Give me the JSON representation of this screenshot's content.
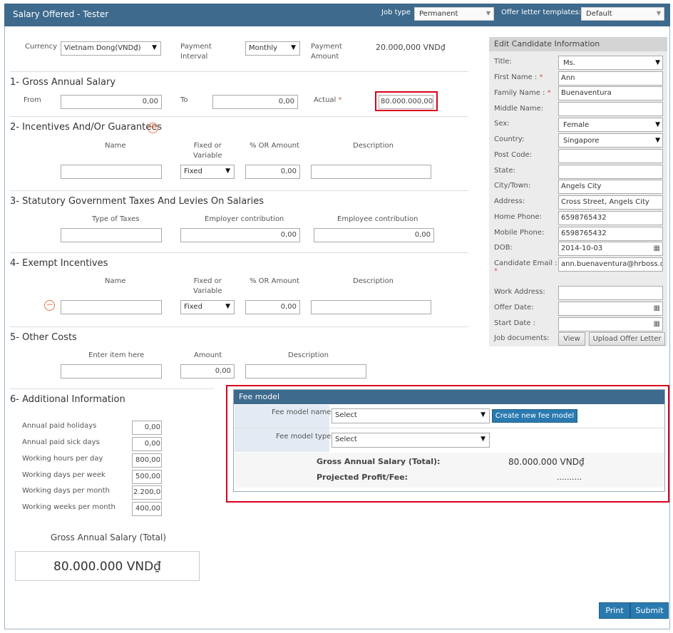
{
  "header": {
    "title": "Salary Offered - Tester",
    "job_type_label": "Job type",
    "job_type_value": "Permanent",
    "templates_label": "Offer letter templates:",
    "templates_value": "Default"
  },
  "top": {
    "currency_label": "Currency",
    "currency_value": "Vietnam Dong(VND₫)",
    "interval_label1": "Payment",
    "interval_label2": "Interval",
    "interval_value": "Monthly",
    "amount_label1": "Payment",
    "amount_label2": "Amount",
    "amount_value": "20.000,000 VND₫"
  },
  "s1": {
    "title": "1- Gross Annual Salary",
    "from_label": "From",
    "from_value": "0,00",
    "to_label": "To",
    "to_value": "0,00",
    "actual_label": "Actual",
    "actual_value": "80.000.000,00"
  },
  "s2": {
    "title": "2- Incentives And/Or Guarantees",
    "col_name": "Name",
    "col_fixed1": "Fixed or",
    "col_fixed2": "Variable",
    "col_pct": "% OR Amount",
    "col_desc": "Description",
    "fixed_value": "Fixed",
    "pct_value": "0,00"
  },
  "s3": {
    "title": "3- Statutory Government Taxes And Levies On Salaries",
    "col_type": "Type of Taxes",
    "col_employer": "Employer contribution",
    "col_employee": "Employee contribution",
    "employer_value": "0,00",
    "employee_value": "0,00"
  },
  "s4": {
    "title": "4- Exempt Incentives",
    "col_name": "Name",
    "col_fixed1": "Fixed or",
    "col_fixed2": "Variable",
    "col_pct": "% OR Amount",
    "col_desc": "Description",
    "fixed_value": "Fixed",
    "pct_value": "0,00"
  },
  "s5": {
    "title": "5- Other Costs",
    "col_item": "Enter item here",
    "col_amount": "Amount",
    "col_desc": "Description",
    "amount_value": "0,00"
  },
  "s6": {
    "title": "6- Additional Information",
    "rows": [
      {
        "label": "Annual paid holidays",
        "value": "0,00"
      },
      {
        "label": "Annual paid sick days",
        "value": "0,00"
      },
      {
        "label": "Working hours per day",
        "value": "800,00"
      },
      {
        "label": "Working days per week",
        "value": "500,00"
      },
      {
        "label": "Working days per month",
        "value": "2.200,00"
      },
      {
        "label": "Working weeks per month",
        "value": "400,00"
      }
    ],
    "total_label": "Gross Annual Salary (Total)",
    "total_value": "80.000.000 VND₫"
  },
  "candidate": {
    "title": "Edit Candidate Information",
    "rows": [
      {
        "label": "Title:",
        "value": "Ms."
      },
      {
        "label": "First Name :",
        "value": "Ann"
      },
      {
        "label": "Family Name :",
        "value": "Buenaventura"
      },
      {
        "label": "Middle Name:",
        "value": ""
      },
      {
        "label": "Sex:",
        "value": "Female"
      },
      {
        "label": "Country:",
        "value": "Singapore"
      },
      {
        "label": "Post Code:",
        "value": ""
      },
      {
        "label": "State:",
        "value": ""
      },
      {
        "label": "City/Town:",
        "value": "Angels City"
      },
      {
        "label": "Address:",
        "value": "Cross Street, Angels City"
      },
      {
        "label": "Home Phone:",
        "value": "6598765432"
      },
      {
        "label": "Mobile Phone:",
        "value": "6598765432"
      },
      {
        "label": "DOB:",
        "value": "2014-10-03"
      },
      {
        "label": "Candidate Email :",
        "value": "ann.buenaventura@hrboss.com"
      },
      {
        "label": "Work Address:",
        "value": ""
      },
      {
        "label": "Offer Date:",
        "value": ""
      },
      {
        "label": "Start Date :",
        "value": ""
      },
      {
        "label": "Job documents:",
        "value": ""
      }
    ],
    "view_btn": "View",
    "upload_btn": "Upload Offer Letter"
  },
  "fee": {
    "title": "Fee model",
    "name_label": "Fee model name",
    "name_value": "Select",
    "create_btn": "Create new fee model",
    "type_label": "Fee model type",
    "type_value": "Select",
    "gross_label": "Gross Annual Salary (Total):",
    "gross_value": "80.000.000 VND₫",
    "profit_label": "Projected Profit/Fee:",
    "profit_value": ".........."
  },
  "footer": {
    "print": "Print",
    "submit": "Submit"
  },
  "icons": {
    "plus": "plus-circle-icon",
    "minus": "minus-circle-icon",
    "calendar": "calendar-icon",
    "caret": "caret-down-icon"
  },
  "colors": {
    "header": "#3d6a8d",
    "accent_red": "#d9001b",
    "button_blue": "#2a7ab0",
    "icon_orange": "#e8734a"
  }
}
